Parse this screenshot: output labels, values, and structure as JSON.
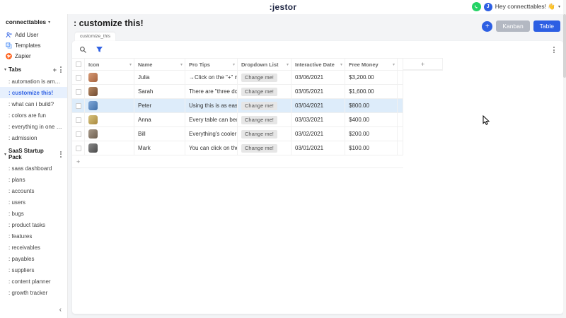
{
  "colors": {
    "accent_blue": "#2d5fe3",
    "whatsapp_green": "#25d366",
    "selected_row_bg": "#ddecfa",
    "selected_sidebar_bg": "#e7f0fd",
    "zapier_orange": "#ff4f00"
  },
  "topbar": {
    "logo": ":jestor",
    "greeting": "Hey connecttables! 👋",
    "avatar_initial": "J"
  },
  "sidebar": {
    "workspace": "connecttables",
    "quick_links": [
      {
        "label": "Add User"
      },
      {
        "label": "Templates"
      },
      {
        "label": "Zapier"
      }
    ],
    "sections": [
      {
        "title": "Tabs",
        "items": [
          {
            "label": ": automation is amazing!"
          },
          {
            "label": ": customize this!",
            "selected": true
          },
          {
            "label": ": what can i build?"
          },
          {
            "label": ": colors are fun"
          },
          {
            "label": ": everything in one pla..."
          },
          {
            "label": ": admission"
          }
        ]
      },
      {
        "title": "SaaS Startup Pack",
        "items": [
          {
            "label": ": saas dashboard"
          },
          {
            "label": ": plans"
          },
          {
            "label": ": accounts"
          },
          {
            "label": ": users"
          },
          {
            "label": ": bugs"
          },
          {
            "label": ": product tasks"
          },
          {
            "label": ": features"
          },
          {
            "label": ": receivables"
          },
          {
            "label": ": payables"
          },
          {
            "label": ": suppliers"
          },
          {
            "label": ": content planner"
          },
          {
            "label": ": growth tracker"
          }
        ]
      }
    ]
  },
  "main": {
    "title": ": customize this!",
    "tab_label": "customize_this",
    "add_button": "+",
    "views": {
      "kanban": "Kanban",
      "table": "Table"
    },
    "active_view": "Table",
    "table": {
      "columns": [
        {
          "label": "Icon"
        },
        {
          "label": "Name"
        },
        {
          "label": "Pro Tips"
        },
        {
          "label": "Dropdown List"
        },
        {
          "label": "Interactive Date"
        },
        {
          "label": "Free Money"
        }
      ],
      "add_column": "+",
      "add_row": "+",
      "rows": [
        {
          "name": "Julia",
          "tip": "→Click on the \"+\" ne...",
          "dropdown": "Change me!",
          "date": "03/06/2021",
          "money": "$3,200.00"
        },
        {
          "name": "Sarah",
          "tip": "There are \"three dots...",
          "dropdown": "Change me!",
          "date": "03/05/2021",
          "money": "$1,600.00"
        },
        {
          "name": "Peter",
          "tip": "Using this is as easy ...",
          "dropdown": "Change me!",
          "date": "03/04/2021",
          "money": "$800.00",
          "highlighted": true
        },
        {
          "name": "Anna",
          "tip": "Every table can beco...",
          "dropdown": "Change me!",
          "date": "03/03/2021",
          "money": "$400.00"
        },
        {
          "name": "Bill",
          "tip": "Everything's cooler ...",
          "dropdown": "Change me!",
          "date": "03/02/2021",
          "money": "$200.00"
        },
        {
          "name": "Mark",
          "tip": "You can click on the ...",
          "dropdown": "Change me!",
          "date": "03/01/2021",
          "money": "$100.00"
        }
      ]
    }
  }
}
